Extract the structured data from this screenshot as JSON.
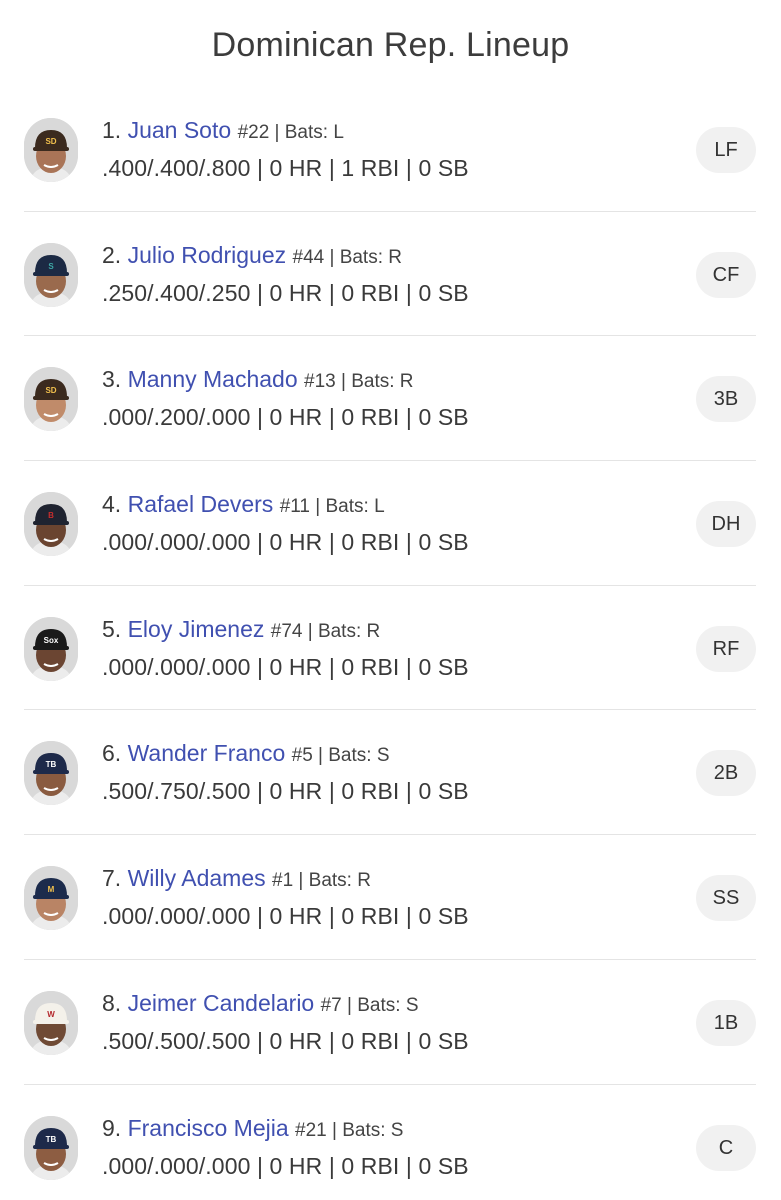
{
  "page": {
    "title": "Dominican Rep. Lineup"
  },
  "lineup": [
    {
      "order": "1.",
      "name": "Juan Soto",
      "meta": "#22 | Bats: L",
      "stats": ".400/.400/.800 | 0 HR | 1 RBI | 0 SB",
      "position": "LF",
      "cap_color": "#3b2a1e",
      "cap_logo": "SD",
      "logo_color": "#f2c14e",
      "skin": "#a97457"
    },
    {
      "order": "2.",
      "name": "Julio Rodriguez",
      "meta": "#44 | Bats: R",
      "stats": ".250/.400/.250 | 0 HR | 0 RBI | 0 SB",
      "position": "CF",
      "cap_color": "#1c2a44",
      "cap_logo": "S",
      "logo_color": "#3ea8a6",
      "skin": "#9a6a4d"
    },
    {
      "order": "3.",
      "name": "Manny Machado",
      "meta": "#13 | Bats: R",
      "stats": ".000/.200/.000 | 0 HR | 0 RBI | 0 SB",
      "position": "3B",
      "cap_color": "#3b2a1e",
      "cap_logo": "SD",
      "logo_color": "#f2c14e",
      "skin": "#c08b6a"
    },
    {
      "order": "4.",
      "name": "Rafael Devers",
      "meta": "#11 | Bats: L",
      "stats": ".000/.000/.000 | 0 HR | 0 RBI | 0 SB",
      "position": "DH",
      "cap_color": "#1f2330",
      "cap_logo": "B",
      "logo_color": "#c62d2d",
      "skin": "#6a4430"
    },
    {
      "order": "5.",
      "name": "Eloy Jimenez",
      "meta": "#74 | Bats: R",
      "stats": ".000/.000/.000 | 0 HR | 0 RBI | 0 SB",
      "position": "RF",
      "cap_color": "#1a1a1a",
      "cap_logo": "Sox",
      "logo_color": "#ffffff",
      "skin": "#6b4532"
    },
    {
      "order": "6.",
      "name": "Wander Franco",
      "meta": "#5 | Bats: S",
      "stats": ".500/.750/.500 | 0 HR | 0 RBI | 0 SB",
      "position": "2B",
      "cap_color": "#1e2a4a",
      "cap_logo": "TB",
      "logo_color": "#ffffff",
      "skin": "#8a5b40"
    },
    {
      "order": "7.",
      "name": "Willy Adames",
      "meta": "#1 | Bats: R",
      "stats": ".000/.000/.000 | 0 HR | 0 RBI | 0 SB",
      "position": "SS",
      "cap_color": "#1c2b4c",
      "cap_logo": "M",
      "logo_color": "#f2c14e",
      "skin": "#b98465"
    },
    {
      "order": "8.",
      "name": "Jeimer Candelario",
      "meta": "#7 | Bats: S",
      "stats": ".500/.500/.500 | 0 HR | 0 RBI | 0 SB",
      "position": "1B",
      "cap_color": "#f4f1ea",
      "cap_logo": "W",
      "logo_color": "#b3262b",
      "skin": "#6f4a35"
    },
    {
      "order": "9.",
      "name": "Francisco Mejia",
      "meta": "#21 | Bats: S",
      "stats": ".000/.000/.000 | 0 HR | 0 RBI | 0 SB",
      "position": "C",
      "cap_color": "#1e2a4a",
      "cap_logo": "TB",
      "logo_color": "#ffffff",
      "skin": "#8d5d42"
    }
  ]
}
